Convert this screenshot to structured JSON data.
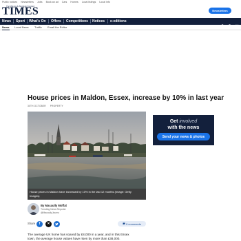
{
  "utility_nav": [
    "Public notices",
    "Newsletters",
    "Jobs",
    "Book an ad",
    "Cars",
    "Homes",
    "Local listings",
    "Local info"
  ],
  "masthead": {
    "kicker": "The Maldon & Burnham Standard",
    "logo_text": "TIMES",
    "newsletters_label": "Newsletters"
  },
  "main_nav": {
    "items": [
      "News",
      "Sport",
      "What's On",
      "Offers",
      "Competitions",
      "Notices",
      "e-editions"
    ],
    "icons": [
      "user-icon",
      "search-icon",
      "menu-icon"
    ],
    "background": "#13203c"
  },
  "sub_nav": {
    "items": [
      "News",
      "Local News",
      "Traffic",
      "Email the Editor"
    ],
    "active": "News"
  },
  "article": {
    "headline": "House prices in Maldon, Essex, increase by 10% in last year",
    "date": "30TH OCTOBER",
    "category": "PROPERTY",
    "image_caption_line1": "House prices in Maldon have increased by 10% in the last 12 months (Image: Getty",
    "image_caption_line2": "Images)",
    "author": {
      "name": "By Macaully Moffat",
      "role": "Trending News Reporter",
      "handle": "@MacaullyJourno"
    },
    "share_label": "Share",
    "share_icons": [
      "facebook-icon",
      "x-icon",
      "twitter-icon"
    ],
    "comments_label": "0 comments",
    "body_line1": "The average UK home has soared by £8,000 in a year, and in this Essex",
    "body_line2": "town, the average house values have risen by more than £38,000."
  },
  "promo": {
    "line1_bold": "Get",
    "line1_light": "involved",
    "line2": "with the news",
    "button_label": "Send your news & photos"
  },
  "colors": {
    "navy": "#13203c",
    "accent_blue": "#1a73e8"
  }
}
